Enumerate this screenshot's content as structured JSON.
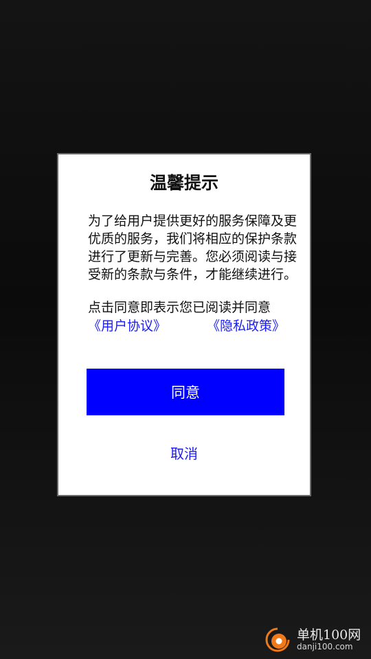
{
  "dialog": {
    "title": "温馨提示",
    "message": "为了给用户提供更好的服务保障及更优质的服务，我们将相应的保护条款进行了更新与完善。您必须阅读与接受新的条款与条件，才能继续进行。",
    "consent": "点击同意即表示您已阅读并同意",
    "links": {
      "user_agreement": "《用户协议》",
      "privacy_policy": "《隐私政策》"
    },
    "agree_label": "同意",
    "cancel_label": "取消"
  },
  "watermark": {
    "name": "单机100网",
    "url": "danji100.com"
  },
  "colors": {
    "accent": "#0000ff",
    "link": "#1a1aff",
    "background": "#0e0e0e",
    "logo_orange": "#f07a1a"
  }
}
